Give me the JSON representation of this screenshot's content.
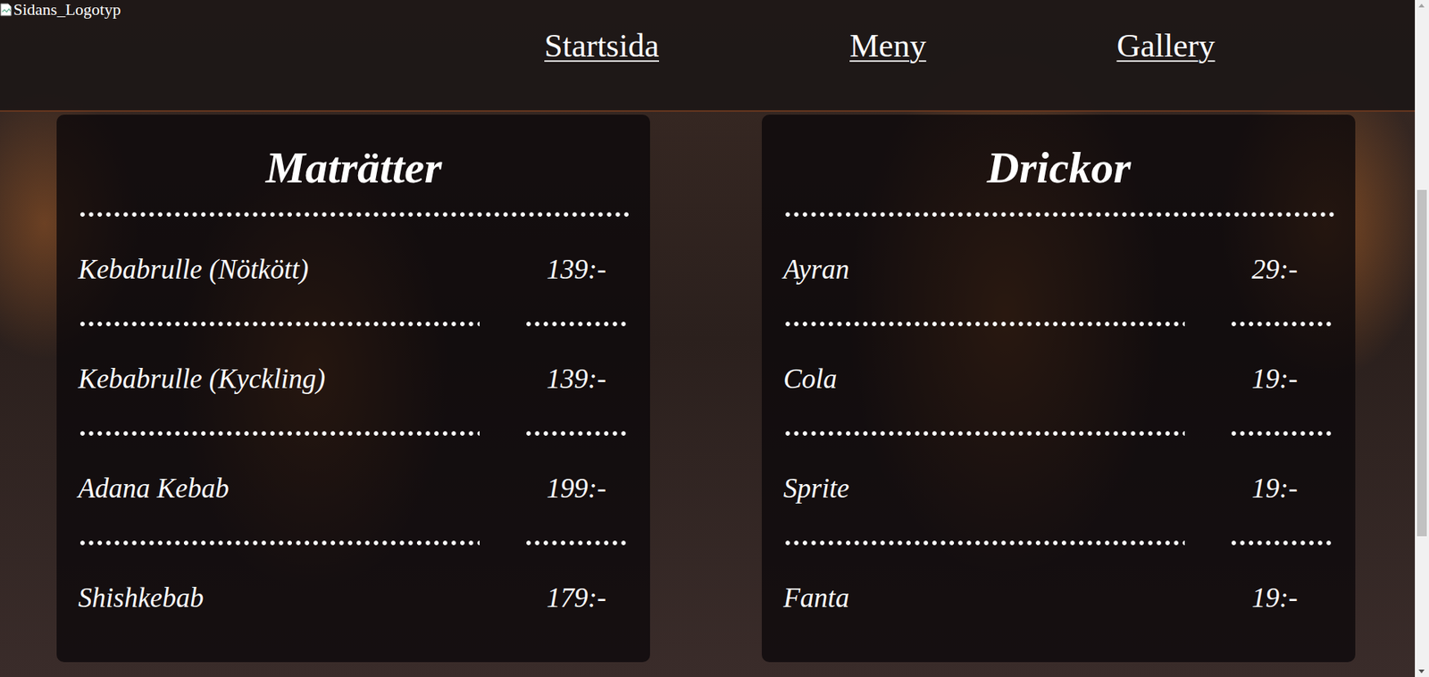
{
  "logo": {
    "alt": "Sidans_Logotyp"
  },
  "nav": [
    {
      "label": "Startsida"
    },
    {
      "label": "Meny"
    },
    {
      "label": "Gallery"
    }
  ],
  "sections": [
    {
      "title": "Maträtter",
      "items": [
        {
          "name": "Kebabrulle (Nötkött)",
          "price": "139:-"
        },
        {
          "name": "Kebabrulle (Kyckling)",
          "price": "139:-"
        },
        {
          "name": "Adana Kebab",
          "price": "199:-"
        },
        {
          "name": "Shishkebab",
          "price": "179:-"
        }
      ]
    },
    {
      "title": "Drickor",
      "items": [
        {
          "name": "Ayran",
          "price": "29:-"
        },
        {
          "name": "Cola",
          "price": "19:-"
        },
        {
          "name": "Sprite",
          "price": "19:-"
        },
        {
          "name": "Fanta",
          "price": "19:-"
        }
      ]
    }
  ]
}
